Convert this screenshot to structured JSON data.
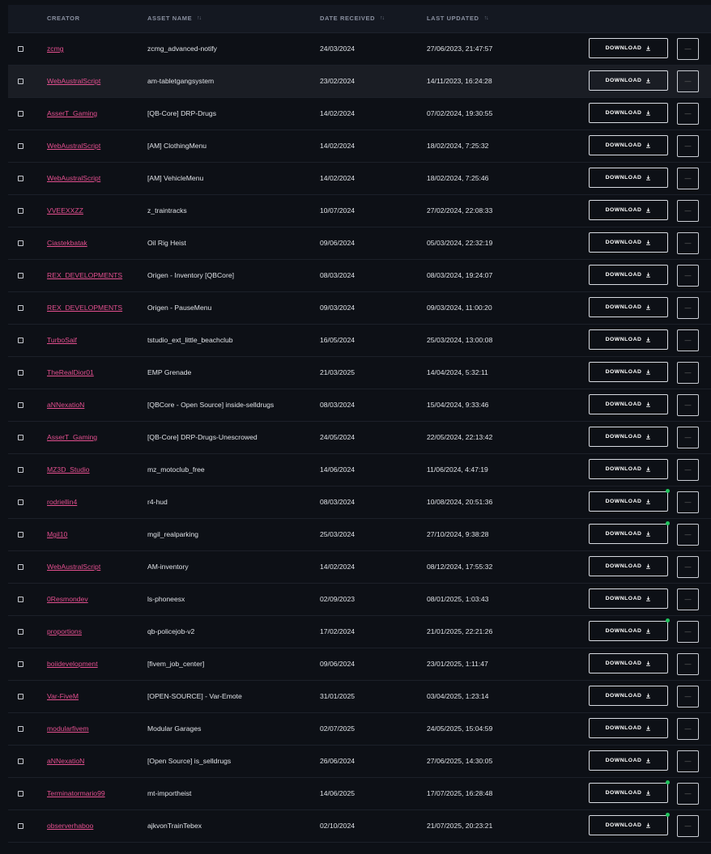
{
  "columns": {
    "creator": "CREATOR",
    "asset": "ASSET NAME",
    "received": "DATE RECEIVED",
    "updated": "LAST UPDATED",
    "sort_glyph": "↑↓"
  },
  "download_label": "DOWNLOAD",
  "more_glyph": "—",
  "colors": {
    "creator_link": "#e34f8f",
    "update_dot": "#22c55e",
    "highlight_row": "#1a1d24"
  },
  "rows": [
    {
      "creator": "zcmg",
      "asset": "zcmg_advanced-notify",
      "received": "24/03/2024",
      "updated": "27/06/2023, 21:47:57",
      "highlight": false,
      "dot": false
    },
    {
      "creator": "WebAustralScript",
      "asset": "am-tabletgangsystem",
      "received": "23/02/2024",
      "updated": "14/11/2023, 16:24:28",
      "highlight": true,
      "dot": false
    },
    {
      "creator": "AsserT_Gaming",
      "asset": "[QB-Core] DRP-Drugs",
      "received": "14/02/2024",
      "updated": "07/02/2024, 19:30:55",
      "highlight": false,
      "dot": false
    },
    {
      "creator": "WebAustralScript",
      "asset": "[AM] ClothingMenu",
      "received": "14/02/2024",
      "updated": "18/02/2024, 7:25:32",
      "highlight": false,
      "dot": false
    },
    {
      "creator": "WebAustralScript",
      "asset": "[AM] VehicleMenu",
      "received": "14/02/2024",
      "updated": "18/02/2024, 7:25:46",
      "highlight": false,
      "dot": false
    },
    {
      "creator": "VVEEXXZZ",
      "asset": "z_traintracks",
      "received": "10/07/2024",
      "updated": "27/02/2024, 22:08:33",
      "highlight": false,
      "dot": false
    },
    {
      "creator": "Ciastekbatak",
      "asset": "Oil Rig Heist",
      "received": "09/06/2024",
      "updated": "05/03/2024, 22:32:19",
      "highlight": false,
      "dot": false
    },
    {
      "creator": "REX_DEVELOPMENTS",
      "asset": "Origen - Inventory [QBCore]",
      "received": "08/03/2024",
      "updated": "08/03/2024, 19:24:07",
      "highlight": false,
      "dot": false
    },
    {
      "creator": "REX_DEVELOPMENTS",
      "asset": "Origen - PauseMenu",
      "received": "09/03/2024",
      "updated": "09/03/2024, 11:00:20",
      "highlight": false,
      "dot": false
    },
    {
      "creator": "TurboSaif",
      "asset": "tstudio_ext_little_beachclub",
      "received": "16/05/2024",
      "updated": "25/03/2024, 13:00:08",
      "highlight": false,
      "dot": false
    },
    {
      "creator": "TheRealDior01",
      "asset": "EMP Grenade",
      "received": "21/03/2025",
      "updated": "14/04/2024, 5:32:11",
      "highlight": false,
      "dot": false
    },
    {
      "creator": "aNNexatioN",
      "asset": "[QBCore - Open Source] inside-selldrugs",
      "received": "08/03/2024",
      "updated": "15/04/2024, 9:33:46",
      "highlight": false,
      "dot": false
    },
    {
      "creator": "AsserT_Gaming",
      "asset": "[QB-Core] DRP-Drugs-Unescrowed",
      "received": "24/05/2024",
      "updated": "22/05/2024, 22:13:42",
      "highlight": false,
      "dot": false
    },
    {
      "creator": "MZ3D_Studio",
      "asset": "mz_motoclub_free",
      "received": "14/06/2024",
      "updated": "11/06/2024, 4:47:19",
      "highlight": false,
      "dot": false
    },
    {
      "creator": "rodriellin4",
      "asset": "r4-hud",
      "received": "08/03/2024",
      "updated": "10/08/2024, 20:51:36",
      "highlight": false,
      "dot": true
    },
    {
      "creator": "Mgil10",
      "asset": "mgil_realparking",
      "received": "25/03/2024",
      "updated": "27/10/2024, 9:38:28",
      "highlight": false,
      "dot": true
    },
    {
      "creator": "WebAustralScript",
      "asset": "AM-inventory",
      "received": "14/02/2024",
      "updated": "08/12/2024, 17:55:32",
      "highlight": false,
      "dot": false
    },
    {
      "creator": "0Resmondev",
      "asset": "ls-phoneesx",
      "received": "02/09/2023",
      "updated": "08/01/2025, 1:03:43",
      "highlight": false,
      "dot": false
    },
    {
      "creator": "proportions",
      "asset": "qb-policejob-v2",
      "received": "17/02/2024",
      "updated": "21/01/2025, 22:21:26",
      "highlight": false,
      "dot": true
    },
    {
      "creator": "boiidevelopment",
      "asset": "[fivem_job_center]",
      "received": "09/06/2024",
      "updated": "23/01/2025, 1:11:47",
      "highlight": false,
      "dot": false
    },
    {
      "creator": "Var-FiveM",
      "asset": "[OPEN-SOURCE] - Var-Emote",
      "received": "31/01/2025",
      "updated": "03/04/2025, 1:23:14",
      "highlight": false,
      "dot": false
    },
    {
      "creator": "modularfivem",
      "asset": "Modular Garages",
      "received": "02/07/2025",
      "updated": "24/05/2025, 15:04:59",
      "highlight": false,
      "dot": false
    },
    {
      "creator": "aNNexatioN",
      "asset": "[Open Source] is_selldrugs",
      "received": "26/06/2024",
      "updated": "27/06/2025, 14:30:05",
      "highlight": false,
      "dot": false
    },
    {
      "creator": "Terminatormario99",
      "asset": "mt-importheist",
      "received": "14/06/2025",
      "updated": "17/07/2025, 16:28:48",
      "highlight": false,
      "dot": true
    },
    {
      "creator": "observerhaboo",
      "asset": "ajkvonTrainTebex",
      "received": "02/10/2024",
      "updated": "21/07/2025, 20:23:21",
      "highlight": false,
      "dot": true
    }
  ]
}
